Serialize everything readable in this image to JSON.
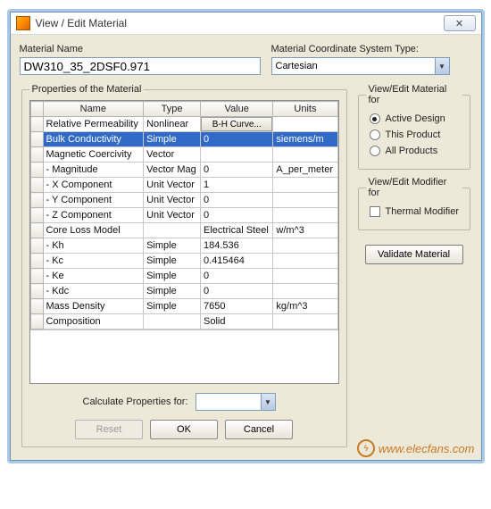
{
  "window": {
    "title": "View / Edit Material",
    "close_glyph": "✕"
  },
  "top": {
    "name_label": "Material Name",
    "name_value": "DW310_35_2DSF0.971",
    "coord_label": "Material Coordinate System Type:",
    "coord_value": "Cartesian"
  },
  "props": {
    "legend": "Properties of the Material",
    "headers": {
      "name": "Name",
      "type": "Type",
      "value": "Value",
      "units": "Units"
    },
    "rows": [
      {
        "name": "Relative Permeability",
        "type": "Nonlinear",
        "value_btn": "B-H Curve...",
        "units": ""
      },
      {
        "name": "Bulk Conductivity",
        "type": "Simple",
        "value": "0",
        "units": "siemens/m",
        "selected": true
      },
      {
        "name": "Magnetic Coercivity",
        "type": "Vector",
        "value": "",
        "units": ""
      },
      {
        "name": "- Magnitude",
        "type": "Vector Mag",
        "value": "0",
        "units": "A_per_meter"
      },
      {
        "name": "- X Component",
        "type": "Unit Vector",
        "value": "1",
        "units": ""
      },
      {
        "name": "- Y Component",
        "type": "Unit Vector",
        "value": "0",
        "units": ""
      },
      {
        "name": "- Z Component",
        "type": "Unit Vector",
        "value": "0",
        "units": ""
      },
      {
        "name": "Core Loss Model",
        "type": "",
        "value": "Electrical Steel",
        "units": "w/m^3"
      },
      {
        "name": " - Kh",
        "type": "Simple",
        "value": "184.536",
        "units": ""
      },
      {
        "name": " - Kc",
        "type": "Simple",
        "value": "0.415464",
        "units": ""
      },
      {
        "name": " - Ke",
        "type": "Simple",
        "value": "0",
        "units": ""
      },
      {
        "name": " - Kdc",
        "type": "Simple",
        "value": "0",
        "units": ""
      },
      {
        "name": "Mass Density",
        "type": "Simple",
        "value": "7650",
        "units": "kg/m^3"
      },
      {
        "name": "Composition",
        "type": "",
        "value": "Solid",
        "units": ""
      }
    ]
  },
  "side": {
    "view_legend": "View/Edit Material for",
    "r_active": "Active Design",
    "r_product": "This Product",
    "r_all": "All Products",
    "mod_legend": "View/Edit Modifier for",
    "c_thermal": "Thermal Modifier",
    "validate": "Validate Material"
  },
  "bottom": {
    "calc_label": "Calculate Properties for:",
    "calc_value": "",
    "reset": "Reset",
    "ok": "OK",
    "cancel": "Cancel"
  },
  "watermark": "www.elecfans.com"
}
